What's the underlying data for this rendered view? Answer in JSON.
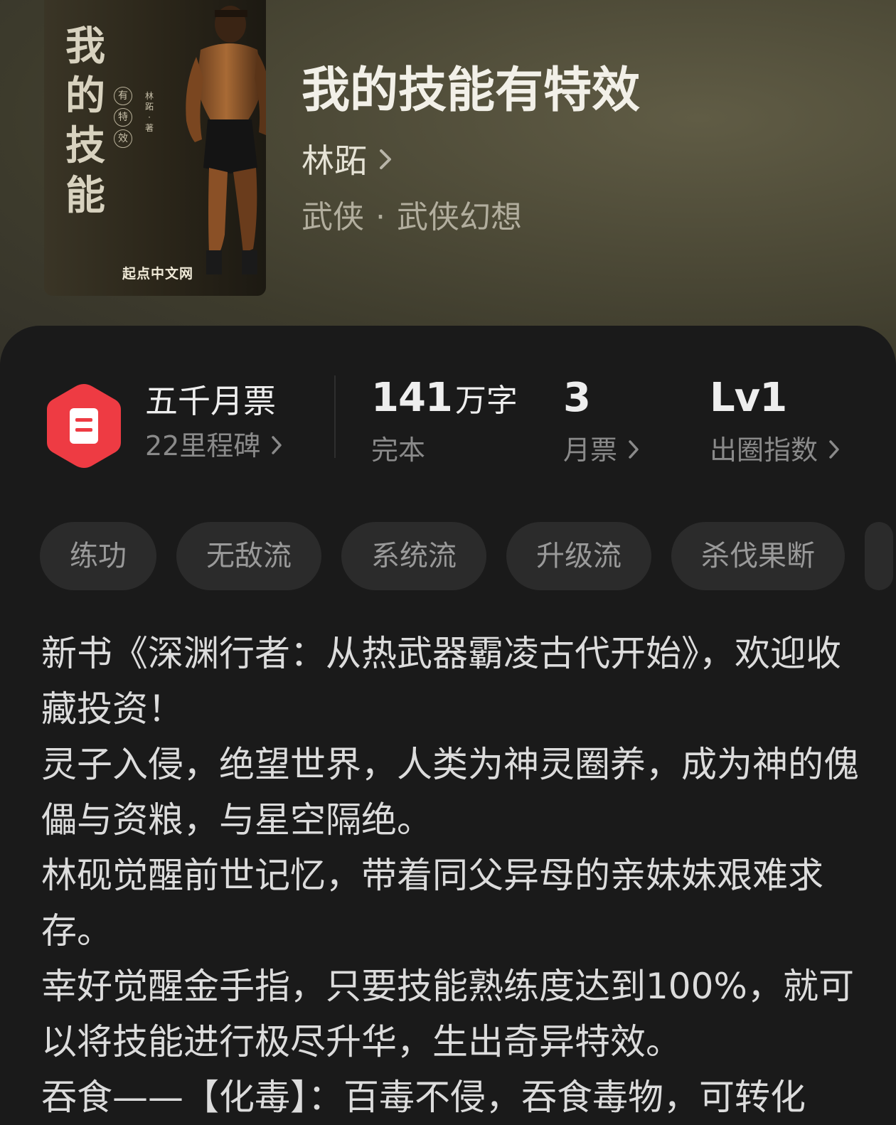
{
  "colors": {
    "hero_bg": "#4d4a37",
    "panel_bg": "#1a1a1a",
    "badge_red": "#ee3b43",
    "tag_bg": "#2b2b2b",
    "text_primary": "#eeeeee",
    "text_secondary": "#8a8a8a"
  },
  "cover": {
    "title_chars": [
      "我",
      "的",
      "技",
      "能"
    ],
    "subtitle_chars": [
      "有",
      "特",
      "效"
    ],
    "author_vertical": "林跖 · 著",
    "publisher": "起点中文网"
  },
  "book": {
    "title": "我的技能有特效",
    "author": "林跖",
    "category": "武侠",
    "subcategory": "武侠幻想"
  },
  "stats": {
    "milestone": {
      "icon": "ticket-hexagon-icon",
      "title": "五千月票",
      "subtitle": "22里程碑"
    },
    "word_count": {
      "value": "141",
      "unit": "万字",
      "status": "完本"
    },
    "monthly_tickets": {
      "value": "3",
      "label": "月票"
    },
    "breakout_index": {
      "value": "Lv1",
      "label": "出圈指数"
    }
  },
  "tags": [
    "练功",
    "无敌流",
    "系统流",
    "升级流",
    "杀伐果断"
  ],
  "intro": [
    "新书《深渊行者：从热武器霸凌古代开始》，欢迎收藏投资！",
    "灵子入侵，绝望世界，人类为神灵圈养，成为神的傀儡与资粮，与星空隔绝。",
    "林砚觉醒前世记忆，带着同父异母的亲妹妹艰难求存。",
    "幸好觉醒金手指，只要技能熟练度达到100%，就可以将技能进行极尽升华，生出奇异特效。",
    "吞食——【化毒】：百毒不侵，吞食毒物，可转化"
  ]
}
